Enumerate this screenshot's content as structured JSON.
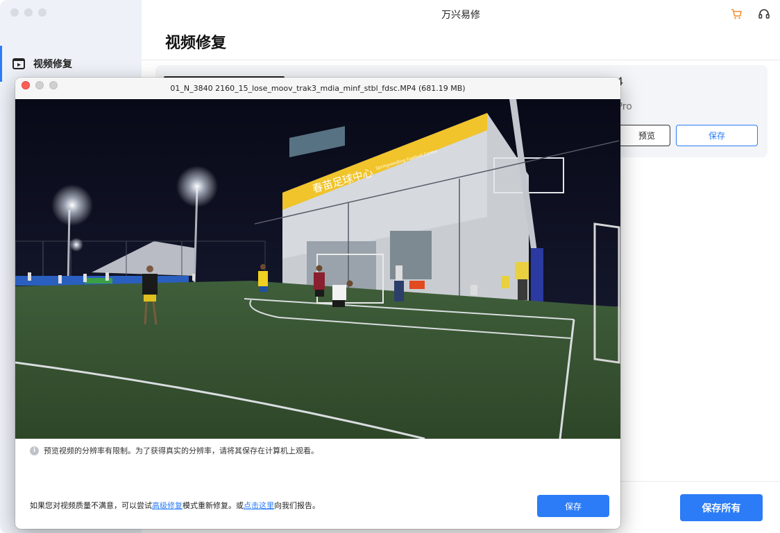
{
  "app": {
    "title": "万兴易修",
    "page_title": "视频修复",
    "sidebar": {
      "items": [
        {
          "label": "视频修复",
          "icon": "video-icon",
          "active": true
        }
      ]
    },
    "toolbar_icons": [
      "cart-icon",
      "headset-icon"
    ],
    "accent_color": "#2b7cf6"
  },
  "file_card": {
    "size_fragment": "4",
    "model_fragment": "oPro",
    "preview_label": "预览",
    "save_label": "保存"
  },
  "footer": {
    "save_all_label": "保存所有"
  },
  "dialog": {
    "title": "01_N_3840 2160_15_lose_moov_trak3_mdia_minf_stbl_fdsc.MP4 (681.19 MB)",
    "video_sign": "春苗足球中心",
    "video_sign_sub": "Springseedling Football Center",
    "notice": "预览视频的分辨率有限制。为了获得真实的分辨率，请将其保存在计算机上观看。",
    "footer_text_1": "如果您对视频质量不满意，可以尝试",
    "footer_link_1": "高级修复",
    "footer_text_2": "模式重新修复。或",
    "footer_link_2": "点击这里",
    "footer_text_3": "向我们报告。",
    "save_label": "保存"
  }
}
